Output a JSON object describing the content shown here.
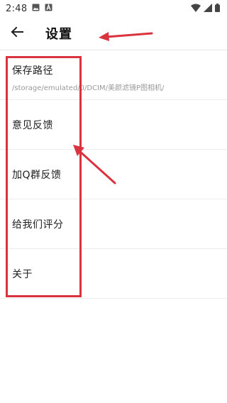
{
  "status_bar": {
    "time": "2:48",
    "icons": [
      "gallery-notification-icon",
      "app-a-notification-icon",
      "wifi-icon",
      "signal-icon",
      "battery-icon"
    ]
  },
  "toolbar": {
    "back_icon": "arrow-left-icon",
    "title": "设置"
  },
  "settings": {
    "items": [
      {
        "label": "保存路径",
        "sub": "/storage/emulated/0/DCIM/美颜滤镜P图相机/"
      },
      {
        "label": "意见反馈"
      },
      {
        "label": "加Q群反馈"
      },
      {
        "label": "给我们评分"
      },
      {
        "label": "关于"
      }
    ]
  },
  "annotation": {
    "color": "#d9333f"
  }
}
